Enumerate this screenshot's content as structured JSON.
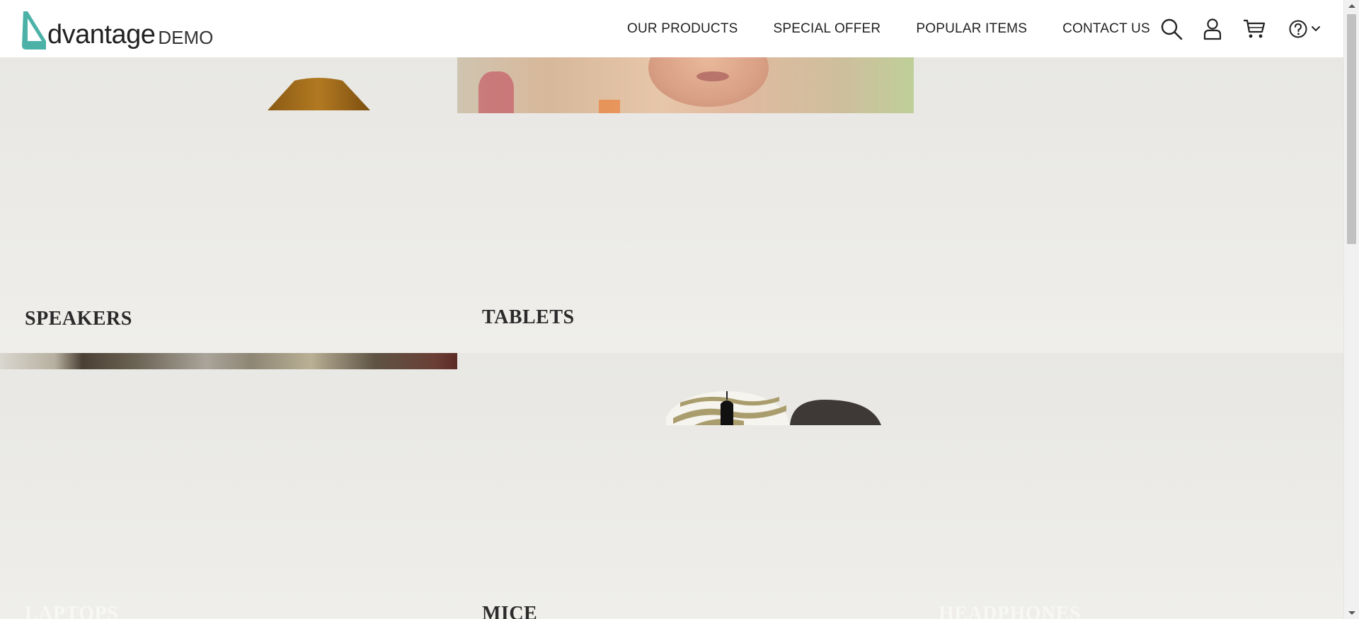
{
  "header": {
    "logo": {
      "brand": "dvantage",
      "suffix": "DEMO",
      "accent_color": "#4cb2a8"
    },
    "nav": [
      {
        "label": "OUR PRODUCTS"
      },
      {
        "label": "SPECIAL OFFER"
      },
      {
        "label": "POPULAR ITEMS"
      },
      {
        "label": "CONTACT US"
      }
    ],
    "icons": [
      "search-icon",
      "user-icon",
      "cart-icon",
      "help-icon",
      "chevron-down-icon"
    ]
  },
  "categories": [
    {
      "label": "SPEAKERS",
      "text_color": "#2b2b2b"
    },
    {
      "label": "TABLETS",
      "text_color": "#2b2b2b"
    },
    {
      "label": "LAPTOPS",
      "text_color": "#f7f7f5"
    },
    {
      "label": "MICE",
      "text_color": "#2b2b2b"
    },
    {
      "label": "HEADPHONES",
      "text_color": "#f7f7f5"
    }
  ]
}
